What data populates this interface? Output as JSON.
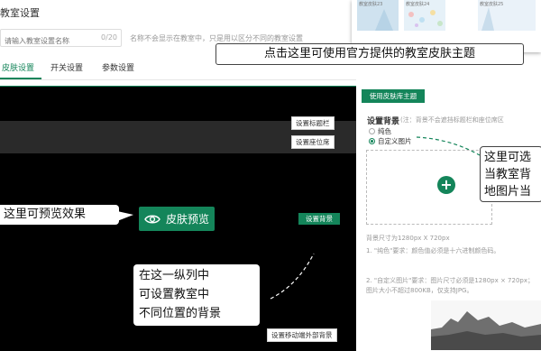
{
  "header": {
    "title": "教室设置",
    "name_placeholder": "请输入教室设置名称",
    "name_count": "0/20",
    "name_hint": "名称不会显示在教室中，只是用以区分不同的教室设置"
  },
  "tabs": [
    {
      "label": "皮肤设置",
      "active": true
    },
    {
      "label": "开关设置",
      "active": false
    },
    {
      "label": "参数设置",
      "active": false
    }
  ],
  "thumbnails": [
    {
      "caption": "教室皮肤23"
    },
    {
      "caption": "教室皮肤24"
    },
    {
      "caption": "教室皮肤25"
    }
  ],
  "preview": {
    "set_titlebar_btn": "设置标题栏",
    "set_seats_btn": "设置座位席",
    "set_background_btn": "设置背景",
    "set_mobile_bg_btn": "设置移动端外部背景",
    "skin_preview_btn": "皮肤预览"
  },
  "settings": {
    "use_skin_library_btn": "使用皮肤库主题",
    "bg_label": "设置背景",
    "bg_note": "(注：背景不会遮挡标题栏和座位席区",
    "radio_solid": "纯色",
    "radio_custom": "自定义图片",
    "upload_icon": "plus-icon",
    "spec": "背景尺寸为1280px X 720px",
    "notes": [
      "1. \"纯色\"要求：颜色值必须是十六进制颜色码。",
      "2. \"自定义图片\"要求：图片尺寸必须是1280px × 720px；图片大小不超过800KB，仅支持JPG。"
    ]
  },
  "callouts": {
    "top": "点击这里可使用官方提供的教室皮肤主题",
    "left": "这里可预览效果",
    "middle_lines": [
      "在这一纵列中",
      "可设置教室中",
      "不同位置的背景"
    ],
    "right_lines": [
      "这里可选",
      "当教室背",
      "地图片当"
    ]
  },
  "colors": {
    "accent": "#14855a",
    "preview_bg": "#000000"
  }
}
